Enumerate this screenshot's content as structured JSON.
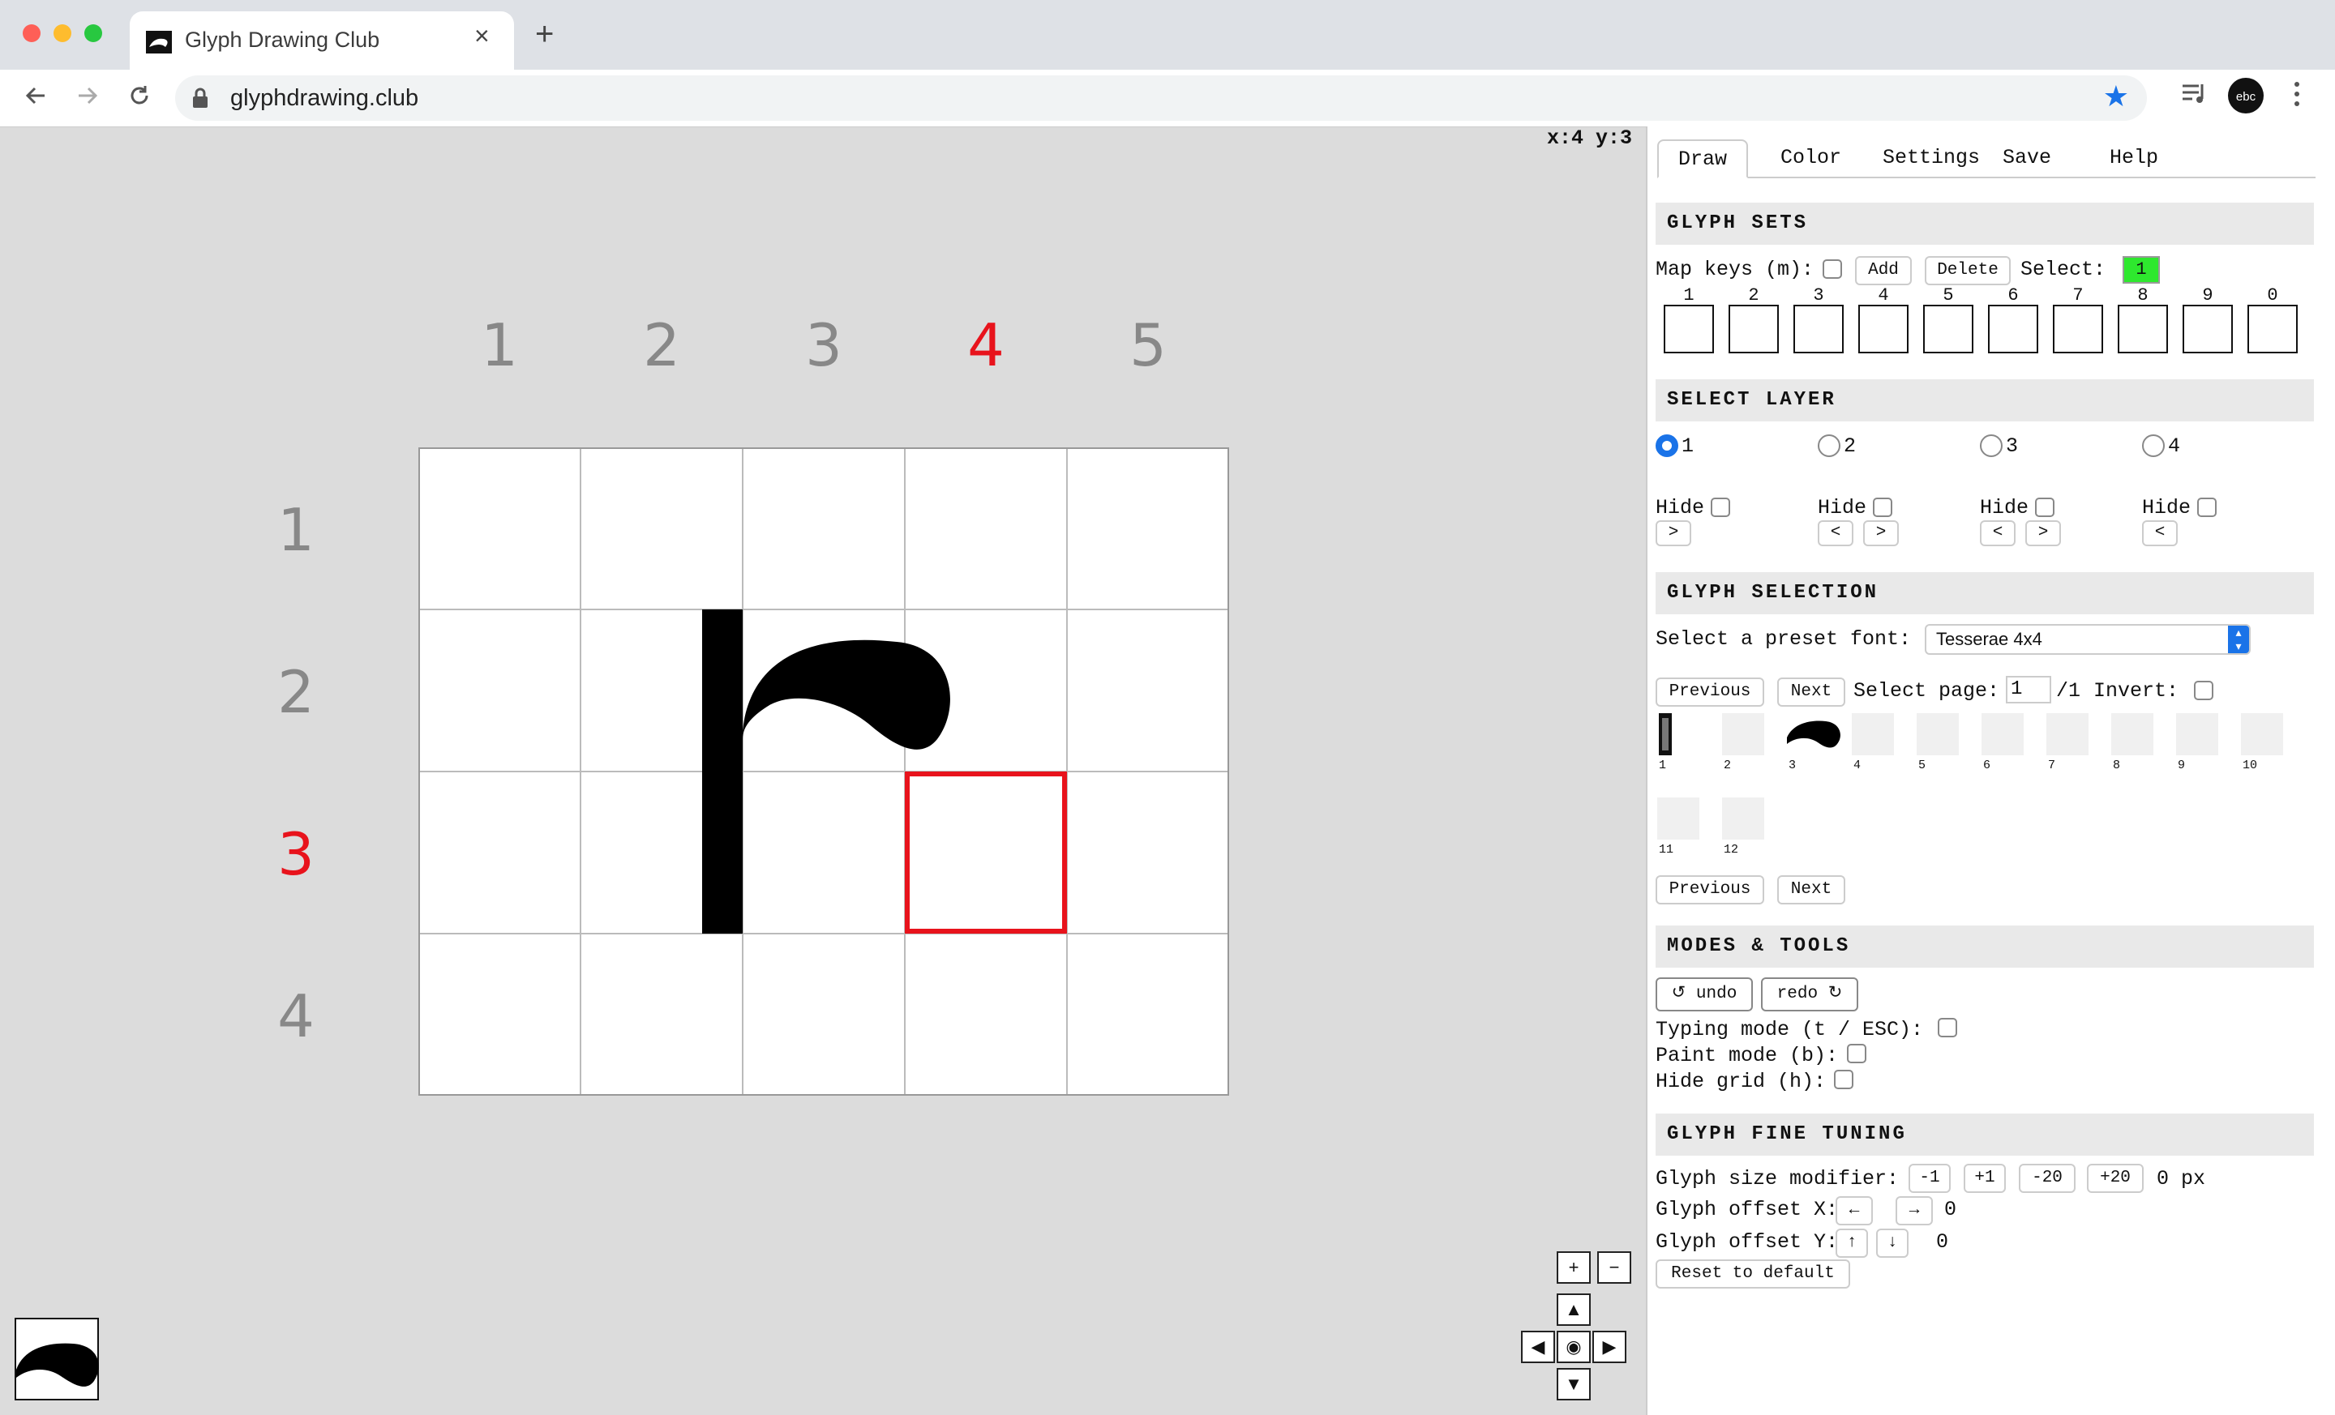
{
  "browser": {
    "tab_title": "Glyph Drawing Club",
    "url": "glyphdrawing.club",
    "new_tab": "+",
    "close": "×"
  },
  "canvas": {
    "coords": "x:4 y:3",
    "columns": [
      "1",
      "2",
      "3",
      "4",
      "5"
    ],
    "rows": [
      "1",
      "2",
      "3",
      "4"
    ],
    "active_column": "4",
    "active_row": "3",
    "accent_color": "#e8131c"
  },
  "nav": {
    "zoom_in": "+",
    "zoom_out": "−",
    "up": "▲",
    "down": "▼",
    "left": "◀",
    "right": "▶",
    "center": "◉"
  },
  "panel": {
    "tabs": [
      "Draw",
      "Color",
      "Settings",
      "Save",
      "Help"
    ],
    "active_tab": "Draw",
    "glyph_sets": {
      "title": "GLYPH SETS",
      "map_keys_label": "Map keys (m):",
      "add": "Add",
      "delete": "Delete",
      "select_label": "Select:",
      "select_value": "1",
      "keys": [
        "1",
        "2",
        "3",
        "4",
        "5",
        "6",
        "7",
        "8",
        "9",
        "0"
      ]
    },
    "select_layer": {
      "title": "SELECT LAYER",
      "layers": [
        "1",
        "2",
        "3",
        "4"
      ],
      "selected": "1",
      "hide_label": "Hide",
      "prev": "<",
      "next": ">"
    },
    "glyph_selection": {
      "title": "GLYPH SELECTION",
      "preset_label": "Select a preset font:",
      "preset_value": "Tesserae 4x4",
      "previous": "Previous",
      "next": "Next",
      "page_label": "Select page:",
      "page_value": "1",
      "page_total": "/1",
      "invert_label": "Invert:",
      "glyph_numbers": [
        "1",
        "2",
        "3",
        "4",
        "5",
        "6",
        "7",
        "8",
        "9",
        "10",
        "11",
        "12"
      ]
    },
    "modes": {
      "title": "MODES & TOOLS",
      "undo": "undo",
      "redo": "redo",
      "typing_mode": "Typing mode (t / ESC):",
      "paint_mode": "Paint mode (b):",
      "hide_grid": "Hide grid (h):"
    },
    "fine_tuning": {
      "title": "GLYPH FINE TUNING",
      "size_label": "Glyph size modifier:",
      "size_buttons": [
        "-1",
        "+1",
        "-20",
        "+20"
      ],
      "size_value": "0 px",
      "offset_x_label": "Glyph offset X:",
      "offset_x_left": "←",
      "offset_x_right": "→",
      "offset_x_value": "0",
      "offset_y_label": "Glyph offset Y:",
      "offset_y_up": "↑",
      "offset_y_down": "↓",
      "offset_y_value": "0",
      "reset": "Reset to default"
    }
  }
}
